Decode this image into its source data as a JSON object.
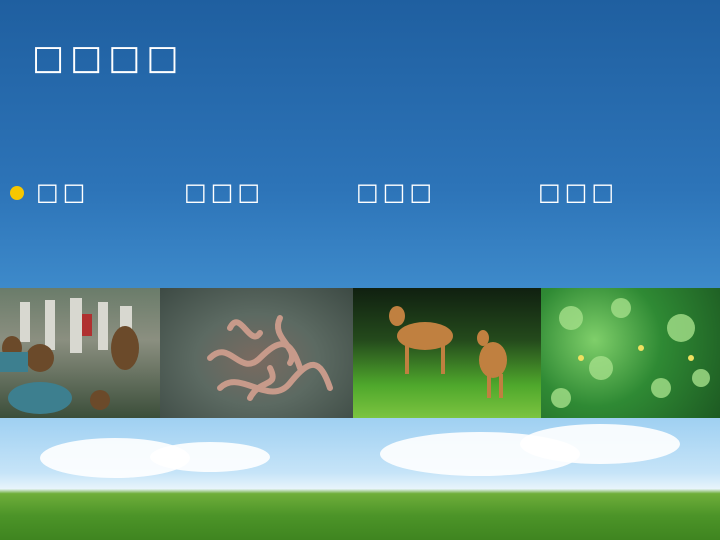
{
  "slide": {
    "title": "□□□□",
    "bullets": [
      {
        "label": "□□"
      },
      {
        "label": "□□□"
      },
      {
        "label": "□□□"
      },
      {
        "label": "□□□"
      }
    ],
    "colors": {
      "bullet": "#f6c700",
      "text": "#ffffff",
      "sky_top": "#1f5fa0"
    },
    "photos": [
      {
        "icon": "tourists-with-monkeys-photo"
      },
      {
        "icon": "snakes-photo"
      },
      {
        "icon": "deer-in-forest-photo"
      },
      {
        "icon": "green-foliage-photo"
      }
    ]
  }
}
